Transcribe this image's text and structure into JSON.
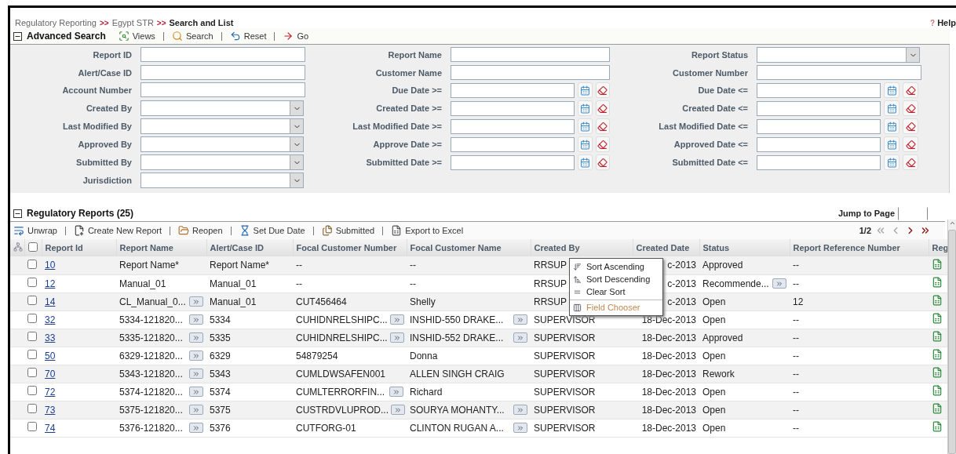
{
  "breadcrumb": [
    {
      "label": "Regulatory Reporting",
      "current": false
    },
    {
      "label": "Egypt STR",
      "current": false
    },
    {
      "label": "Search and List",
      "current": true
    }
  ],
  "separator": ">>",
  "help": {
    "icon": "?",
    "label": "Help"
  },
  "search": {
    "title": "Advanced Search",
    "expanded": true,
    "actions": [
      {
        "kind": "views",
        "label": "Views"
      },
      {
        "kind": "search",
        "label": "Search"
      },
      {
        "kind": "reset",
        "label": "Reset"
      },
      {
        "kind": "go",
        "label": "Go"
      }
    ],
    "fields": [
      {
        "label": "Report ID",
        "kind": "text"
      },
      {
        "label": "Report Name",
        "kind": "text"
      },
      {
        "label": "Report Status",
        "kind": "select"
      },
      {
        "label": "Alert/Case ID",
        "kind": "text"
      },
      {
        "label": "Customer Name",
        "kind": "text"
      },
      {
        "label": "Customer Number",
        "kind": "text"
      },
      {
        "label": "Account Number",
        "kind": "text"
      },
      {
        "label": "Due Date >=",
        "kind": "date"
      },
      {
        "label": "Due Date <=",
        "kind": "date"
      },
      {
        "label": "Created By",
        "kind": "select"
      },
      {
        "label": "Created Date >=",
        "kind": "date"
      },
      {
        "label": "Created Date <=",
        "kind": "date"
      },
      {
        "label": "Last Modified By",
        "kind": "select"
      },
      {
        "label": "Last Modified Date >=",
        "kind": "date"
      },
      {
        "label": "Last Modified Date <=",
        "kind": "date"
      },
      {
        "label": "Approved By",
        "kind": "select"
      },
      {
        "label": "Approve Date >=",
        "kind": "date"
      },
      {
        "label": "Approved Date <=",
        "kind": "date"
      },
      {
        "label": "Submitted By",
        "kind": "select"
      },
      {
        "label": "Submitted Date >=",
        "kind": "date"
      },
      {
        "label": "Submitted Date <=",
        "kind": "date"
      },
      {
        "label": "Jurisdiction",
        "kind": "select"
      }
    ]
  },
  "reports": {
    "title": "Regulatory Reports (25)",
    "expanded": true,
    "jump_label": "Jump to Page",
    "actions": [
      {
        "kind": "unwrap",
        "label": "Unwrap"
      },
      {
        "kind": "create",
        "label": "Create New Report"
      },
      {
        "kind": "reopen",
        "label": "Reopen"
      },
      {
        "kind": "due",
        "label": "Set Due Date"
      },
      {
        "kind": "submitted",
        "label": "Submitted"
      },
      {
        "kind": "export",
        "label": "Export to Excel"
      }
    ],
    "pager": {
      "page": "1/2",
      "buttons": [
        {
          "kind": "first",
          "disabled": true
        },
        {
          "kind": "prev",
          "disabled": true
        },
        {
          "kind": "next",
          "disabled": false
        },
        {
          "kind": "last",
          "disabled": false
        }
      ]
    },
    "all_checked": false,
    "columns": [
      {
        "label": "Report Id",
        "kind": "link"
      },
      {
        "label": "Report Name",
        "kind": "text"
      },
      {
        "label": "Alert/Case ID",
        "kind": "text"
      },
      {
        "label": "Focal Customer Number",
        "kind": "text"
      },
      {
        "label": "Focal Customer Name",
        "kind": "text"
      },
      {
        "label": "Created By",
        "kind": "text"
      },
      {
        "label": "Created Date",
        "kind": "date"
      },
      {
        "label": "Status",
        "kind": "text"
      },
      {
        "label": "Report Reference Number",
        "kind": "text"
      },
      {
        "label": "Reg",
        "kind": "icon"
      }
    ],
    "rows": [
      {
        "checked": false,
        "cells": [
          {
            "text": "10",
            "more": false
          },
          {
            "text": "Report Name*",
            "more": false
          },
          {
            "text": "Report Name*",
            "more": false
          },
          {
            "text": "--",
            "more": false
          },
          {
            "text": "--",
            "more": false
          },
          {
            "text": "RRSUP",
            "more": false
          },
          {
            "text": "c-2013",
            "more": false
          },
          {
            "text": "Approved",
            "more": false
          },
          {
            "text": "--",
            "more": false
          }
        ]
      },
      {
        "checked": false,
        "cells": [
          {
            "text": "12",
            "more": false
          },
          {
            "text": "Manual_01",
            "more": false
          },
          {
            "text": "Manual_01",
            "more": false
          },
          {
            "text": "--",
            "more": false
          },
          {
            "text": "--",
            "more": false
          },
          {
            "text": "RRSUP",
            "more": false
          },
          {
            "text": "c-2013",
            "more": false
          },
          {
            "text": "Recommende...",
            "more": true
          },
          {
            "text": "--",
            "more": false
          }
        ]
      },
      {
        "checked": false,
        "cells": [
          {
            "text": "14",
            "more": false
          },
          {
            "text": "CL_Manual_0...",
            "more": true
          },
          {
            "text": "Manual_01",
            "more": false
          },
          {
            "text": "CUT456464",
            "more": false
          },
          {
            "text": "Shelly",
            "more": false
          },
          {
            "text": "RRSUP",
            "more": false
          },
          {
            "text": "c-2013",
            "more": false
          },
          {
            "text": "Open",
            "more": false
          },
          {
            "text": "12",
            "more": false
          }
        ]
      },
      {
        "checked": false,
        "cells": [
          {
            "text": "32",
            "more": false
          },
          {
            "text": "5334-121820...",
            "more": true
          },
          {
            "text": "5334",
            "more": false
          },
          {
            "text": "CUHIDNRELSHIPC...",
            "more": true
          },
          {
            "text": "INSHID-550 DRAKE...",
            "more": true
          },
          {
            "text": "SUPERVISOR",
            "more": false
          },
          {
            "text": "18-Dec-2013",
            "more": false
          },
          {
            "text": "Open",
            "more": false
          },
          {
            "text": "--",
            "more": false
          }
        ]
      },
      {
        "checked": false,
        "cells": [
          {
            "text": "33",
            "more": false
          },
          {
            "text": "5335-121820...",
            "more": true
          },
          {
            "text": "5335",
            "more": false
          },
          {
            "text": "CUHIDNRELSHIPC...",
            "more": true
          },
          {
            "text": "INSHID-552 DRAKE...",
            "more": true
          },
          {
            "text": "SUPERVISOR",
            "more": false
          },
          {
            "text": "18-Dec-2013",
            "more": false
          },
          {
            "text": "Approved",
            "more": false
          },
          {
            "text": "--",
            "more": false
          }
        ]
      },
      {
        "checked": false,
        "cells": [
          {
            "text": "50",
            "more": false
          },
          {
            "text": "6329-121820...",
            "more": true
          },
          {
            "text": "6329",
            "more": false
          },
          {
            "text": "54879254",
            "more": false
          },
          {
            "text": "Donna",
            "more": false
          },
          {
            "text": "SUPERVISOR",
            "more": false
          },
          {
            "text": "18-Dec-2013",
            "more": false
          },
          {
            "text": "Open",
            "more": false
          },
          {
            "text": "--",
            "more": false
          }
        ]
      },
      {
        "checked": false,
        "cells": [
          {
            "text": "70",
            "more": false
          },
          {
            "text": "5343-121820...",
            "more": true
          },
          {
            "text": "5343",
            "more": false
          },
          {
            "text": "CUMLDWSAFEN001",
            "more": false
          },
          {
            "text": "ALLEN SINGH CRAIG",
            "more": false
          },
          {
            "text": "SUPERVISOR",
            "more": false
          },
          {
            "text": "18-Dec-2013",
            "more": false
          },
          {
            "text": "Rework",
            "more": false
          },
          {
            "text": "--",
            "more": false
          }
        ]
      },
      {
        "checked": false,
        "cells": [
          {
            "text": "72",
            "more": false
          },
          {
            "text": "5374-121820...",
            "more": true
          },
          {
            "text": "5374",
            "more": false
          },
          {
            "text": "CUMLTERRORFIN...",
            "more": true
          },
          {
            "text": "Richard",
            "more": false
          },
          {
            "text": "SUPERVISOR",
            "more": false
          },
          {
            "text": "18-Dec-2013",
            "more": false
          },
          {
            "text": "Open",
            "more": false
          },
          {
            "text": "--",
            "more": false
          }
        ]
      },
      {
        "checked": false,
        "cells": [
          {
            "text": "73",
            "more": false
          },
          {
            "text": "5375-121820...",
            "more": true
          },
          {
            "text": "5375",
            "more": false
          },
          {
            "text": "CUSTRDVLUPROD...",
            "more": true
          },
          {
            "text": "SOURYA MOHANTY...",
            "more": true
          },
          {
            "text": "SUPERVISOR",
            "more": false
          },
          {
            "text": "18-Dec-2013",
            "more": false
          },
          {
            "text": "Open",
            "more": false
          },
          {
            "text": "--",
            "more": false
          }
        ]
      },
      {
        "checked": false,
        "cells": [
          {
            "text": "74",
            "more": false
          },
          {
            "text": "5376-121820...",
            "more": true
          },
          {
            "text": "5376",
            "more": false
          },
          {
            "text": "CUTFORG-01",
            "more": false
          },
          {
            "text": "CLINTON RUGAN A...",
            "more": true
          },
          {
            "text": "SUPERVISOR",
            "more": false
          },
          {
            "text": "18-Dec-2013",
            "more": false
          },
          {
            "text": "Open",
            "more": false
          },
          {
            "text": "--",
            "more": false
          }
        ]
      }
    ],
    "context_menu": {
      "items": [
        {
          "kind": "asc",
          "label": "Sort Ascending",
          "selected": false
        },
        {
          "kind": "desc",
          "label": "Sort Descending",
          "selected": false
        },
        {
          "kind": "clear",
          "label": "Clear Sort",
          "selected": false
        },
        {
          "kind": "chooser",
          "label": "Field Chooser",
          "selected": true
        }
      ]
    }
  }
}
